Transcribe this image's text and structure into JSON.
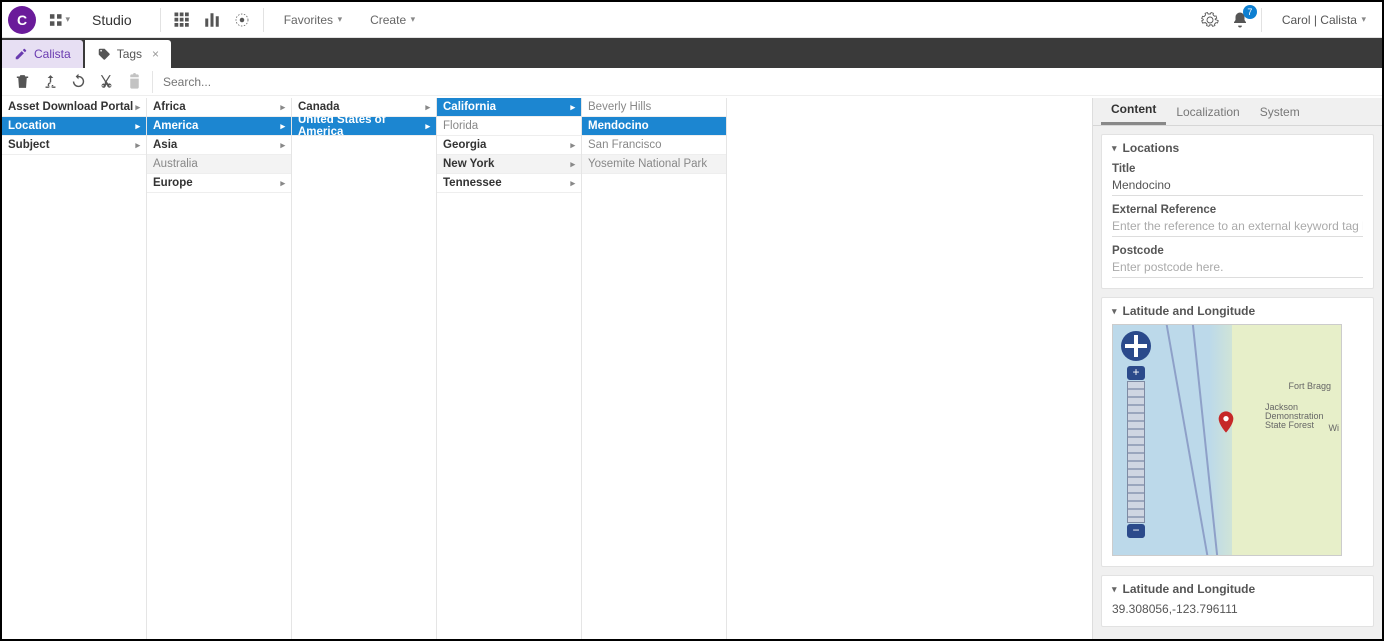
{
  "top": {
    "app": "Studio",
    "favorites": "Favorites",
    "create": "Create",
    "user": "Carol | Calista",
    "notif_count": "7"
  },
  "tabs": [
    {
      "label": "Calista"
    },
    {
      "label": "Tags"
    }
  ],
  "search_placeholder": "Search...",
  "cols": {
    "c1": [
      {
        "t": "Asset Download Portal",
        "a": true,
        "b": true
      },
      {
        "t": "Location",
        "sel": true,
        "a": true
      },
      {
        "t": "Subject",
        "b": true,
        "a": true
      }
    ],
    "c2": [
      {
        "t": "Africa",
        "b": true,
        "a": true
      },
      {
        "t": "America",
        "sel": true,
        "a": true
      },
      {
        "t": "Asia",
        "b": true,
        "a": true
      },
      {
        "t": "Australia",
        "muted": true,
        "hover": true
      },
      {
        "t": "Europe",
        "b": true,
        "a": true
      }
    ],
    "c3": [
      {
        "t": "Canada",
        "b": true,
        "a": true
      },
      {
        "t": "United States of America",
        "sel": true,
        "a": true
      }
    ],
    "c4": [
      {
        "t": "California",
        "sel": true,
        "a": true
      },
      {
        "t": "Florida",
        "muted": true
      },
      {
        "t": "Georgia",
        "b": true,
        "a": true
      },
      {
        "t": "New York",
        "b": true,
        "a": true,
        "hover": true
      },
      {
        "t": "Tennessee",
        "b": true,
        "a": true
      }
    ],
    "c5": [
      {
        "t": "Beverly Hills",
        "muted": true
      },
      {
        "t": "Mendocino",
        "sel": true
      },
      {
        "t": "San Francisco",
        "muted": true
      },
      {
        "t": "Yosemite National Park",
        "muted": true,
        "hover": true
      }
    ]
  },
  "panel": {
    "tabs": {
      "content": "Content",
      "localization": "Localization",
      "system": "System"
    },
    "locations": {
      "heading": "Locations",
      "title_label": "Title",
      "title_value": "Mendocino",
      "extref_label": "External Reference",
      "extref_ph": "Enter the reference to an external keyword tag here.",
      "postcode_label": "Postcode",
      "postcode_ph": "Enter postcode here."
    },
    "latlong_heading": "Latitude and Longitude",
    "latlong_value": "39.308056,-123.796111",
    "map": {
      "city1": "Fort Bragg",
      "city2": "Jackson Demonstration State Forest",
      "city3": "Wi"
    }
  }
}
